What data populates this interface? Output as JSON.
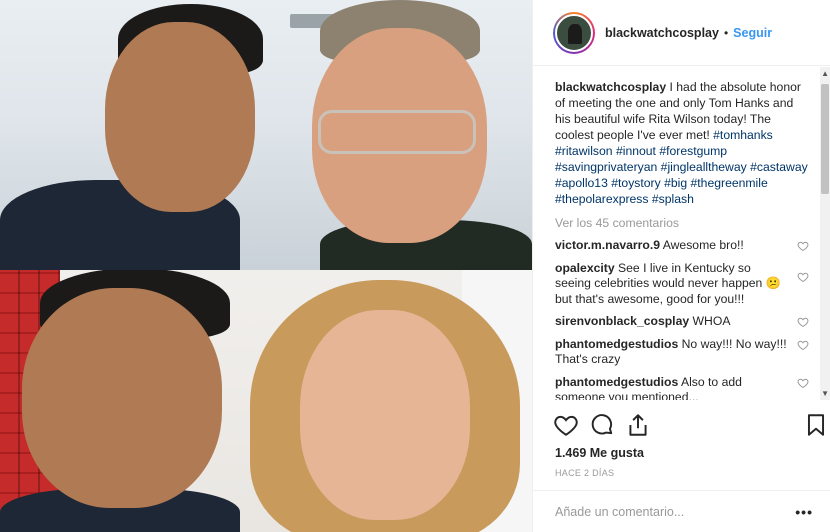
{
  "header": {
    "username": "blackwatchcosplay",
    "separator": "•",
    "follow_label": "Seguir"
  },
  "caption": {
    "username": "blackwatchcosplay",
    "text": "I had the absolute honor of meeting the one and only Tom Hanks and his beautiful wife Rita Wilson today! The coolest people I've ever met!",
    "hashtags": "#tomhanks #ritawilson #innout #forestgump #savingprivateryan #jinglealltheway #castaway #apollo13 #toystory #big #thegreenmile #thepolarexpress #splash"
  },
  "view_all": "Ver los 45 comentarios",
  "comments": [
    {
      "user": "victor.m.navarro.9",
      "text": "Awesome bro!!"
    },
    {
      "user": "opalexcity",
      "text": "See I live in Kentucky so seeing celebrities would never happen 😕 but that's awesome, good for you!!!"
    },
    {
      "user": "sirenvonblack_cosplay",
      "text": "WHOA"
    },
    {
      "user": "phantomedgestudios",
      "text": "No way!!! No way!!! That's crazy"
    },
    {
      "user": "phantomedgestudios",
      "text": "Also to add someone you mentioned..."
    }
  ],
  "likes": "1.469 Me gusta",
  "time": "HACE 2 DÍAS",
  "add_comment": {
    "placeholder": "Añade un comentario...",
    "more_label": "•••"
  },
  "icons": {
    "heart": "heart-icon",
    "comment": "comment-icon",
    "share": "share-icon",
    "save": "bookmark-icon"
  },
  "colors": {
    "follow": "#3897f0",
    "hashtag": "#003569",
    "muted": "#999999"
  }
}
